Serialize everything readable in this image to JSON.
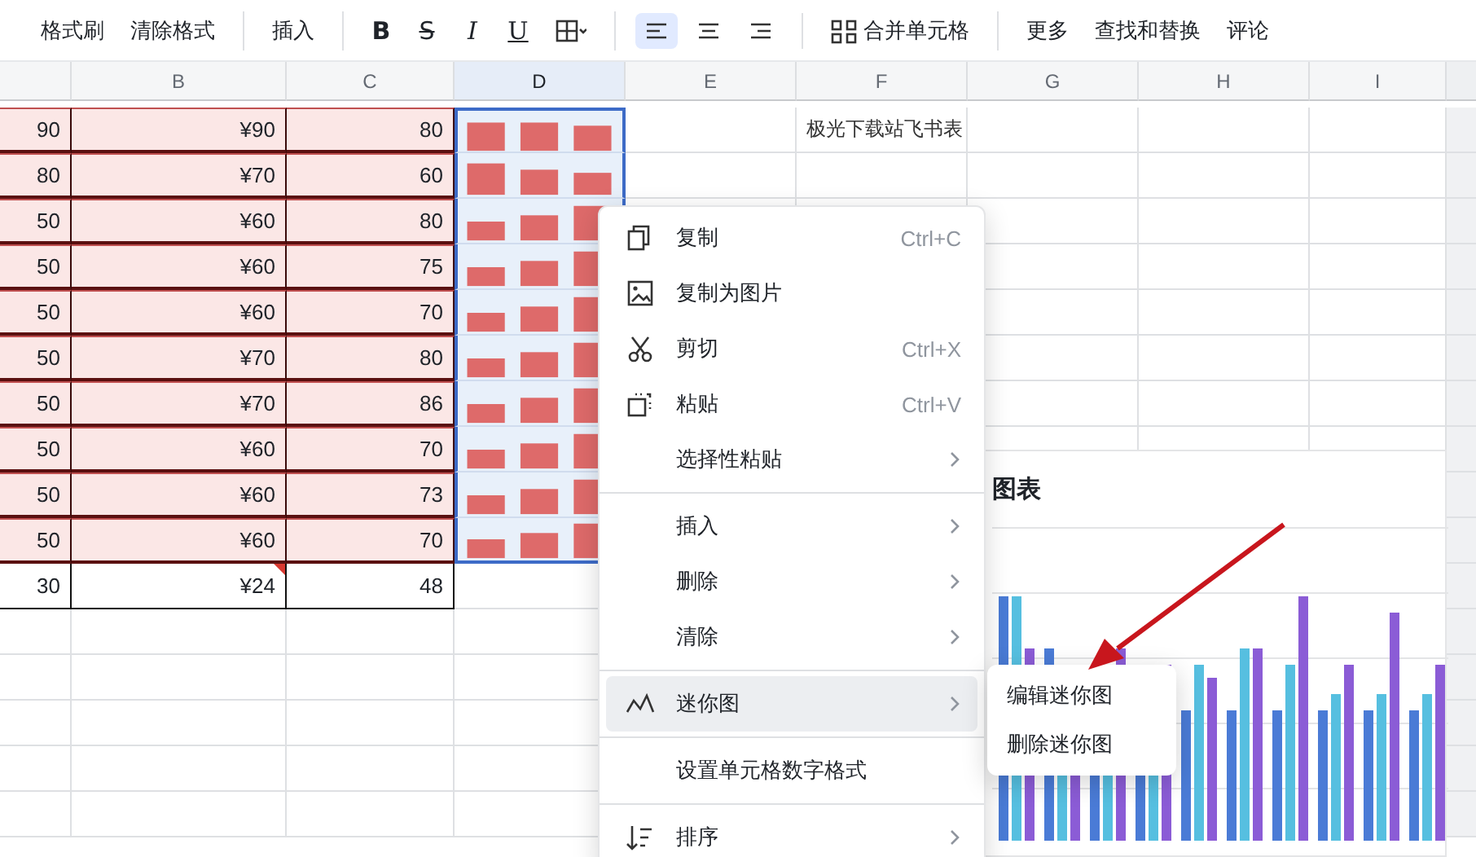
{
  "toolbar": {
    "groups": [
      [
        {
          "kind": "text",
          "label": "格式刷"
        },
        {
          "kind": "text",
          "label": "清除格式"
        }
      ],
      [
        {
          "kind": "text",
          "label": "插入"
        }
      ],
      [
        {
          "kind": "bold",
          "label": "B"
        },
        {
          "kind": "strike",
          "label": "S"
        },
        {
          "kind": "italic",
          "label": "I"
        },
        {
          "kind": "underline",
          "label": "U"
        },
        {
          "kind": "borders"
        }
      ],
      [
        {
          "kind": "align-left",
          "selected": true
        },
        {
          "kind": "align-center",
          "selected": false
        },
        {
          "kind": "align-right",
          "selected": false
        }
      ],
      [
        {
          "kind": "merge",
          "label": "合并单元格"
        }
      ],
      [
        {
          "kind": "text",
          "label": "更多"
        },
        {
          "kind": "text",
          "label": "查找和替换"
        },
        {
          "kind": "text",
          "label": "评论"
        }
      ]
    ]
  },
  "sheet": {
    "columns": [
      {
        "selected": false
      },
      {
        "label": "B",
        "selected": false
      },
      {
        "label": "C",
        "selected": false
      },
      {
        "label": "D",
        "selected": true
      },
      {
        "label": "E",
        "selected": false
      },
      {
        "label": "F",
        "selected": false
      },
      {
        "label": "G",
        "selected": false
      },
      {
        "label": "H",
        "selected": false
      },
      {
        "label": "I",
        "selected": false
      }
    ],
    "rows": [
      {
        "cells": {
          "A": "90",
          "B": "¥90",
          "C": "80",
          "F": "极光下载站飞书表"
        },
        "highlighted": true,
        "sparkline": true,
        "comment": false
      },
      {
        "cells": {
          "A": "80",
          "B": "¥70",
          "C": "60"
        },
        "highlighted": true,
        "sparkline": true,
        "comment": false
      },
      {
        "cells": {
          "A": "50",
          "B": "¥60",
          "C": "80"
        },
        "highlighted": true,
        "sparkline": true,
        "comment": false
      },
      {
        "cells": {
          "A": "50",
          "B": "¥60",
          "C": "75"
        },
        "highlighted": true,
        "sparkline": true,
        "comment": false
      },
      {
        "cells": {
          "A": "50",
          "B": "¥60",
          "C": "70"
        },
        "highlighted": true,
        "sparkline": true,
        "comment": false
      },
      {
        "cells": {
          "A": "50",
          "B": "¥70",
          "C": "80"
        },
        "highlighted": true,
        "sparkline": true,
        "comment": false
      },
      {
        "cells": {
          "A": "50",
          "B": "¥70",
          "C": "86"
        },
        "highlighted": true,
        "sparkline": true,
        "comment": false
      },
      {
        "cells": {
          "A": "50",
          "B": "¥60",
          "C": "70"
        },
        "highlighted": true,
        "sparkline": true,
        "comment": false
      },
      {
        "cells": {
          "A": "50",
          "B": "¥60",
          "C": "73"
        },
        "highlighted": true,
        "sparkline": true,
        "comment": false
      },
      {
        "cells": {
          "A": "50",
          "B": "¥60",
          "C": "70"
        },
        "highlighted": true,
        "sparkline": true,
        "comment": false
      },
      {
        "cells": {
          "A": "30",
          "B": "¥24",
          "C": "48"
        },
        "highlighted": false,
        "sparkline": false,
        "comment": true
      }
    ]
  },
  "chart": {
    "title": "图表"
  },
  "context_menu": {
    "groups": [
      [
        {
          "label": "复制",
          "shortcut": "Ctrl+C",
          "submenu_arrow": false,
          "highlighted": false
        },
        {
          "label": "复制为图片",
          "submenu_arrow": false,
          "highlighted": false
        },
        {
          "label": "剪切",
          "shortcut": "Ctrl+X",
          "submenu_arrow": false,
          "highlighted": false
        },
        {
          "label": "粘贴",
          "shortcut": "Ctrl+V",
          "submenu_arrow": false,
          "highlighted": false
        },
        {
          "label": "选择性粘贴",
          "submenu_arrow": true,
          "highlighted": false
        }
      ],
      [
        {
          "label": "插入",
          "submenu_arrow": true,
          "highlighted": false
        },
        {
          "label": "删除",
          "submenu_arrow": true,
          "highlighted": false
        },
        {
          "label": "清除",
          "submenu_arrow": true,
          "highlighted": false
        }
      ],
      [
        {
          "label": "迷你图",
          "submenu_arrow": true,
          "highlighted": true,
          "submenu": [
            "编辑迷你图",
            "删除迷你图"
          ]
        }
      ],
      [
        {
          "label": "设置单元格数字格式",
          "submenu_arrow": false,
          "highlighted": false
        }
      ],
      [
        {
          "label": "排序",
          "submenu_arrow": true,
          "highlighted": false
        }
      ]
    ]
  }
}
